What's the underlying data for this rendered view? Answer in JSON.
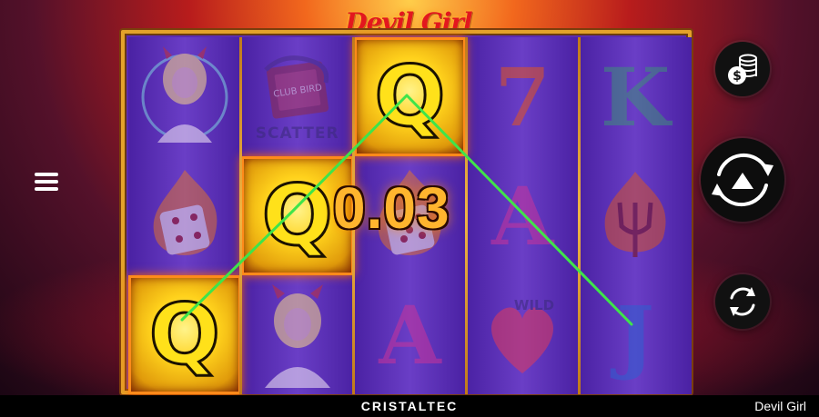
{
  "game": {
    "logo_text": "Devil Girl",
    "win_amount": "0.03"
  },
  "reels": [
    {
      "name": "reel-1",
      "symbols": [
        "girl",
        "dice",
        "Q"
      ]
    },
    {
      "name": "reel-2",
      "symbols": [
        "scatter-book",
        "Q",
        "girl"
      ]
    },
    {
      "name": "reel-3",
      "symbols": [
        "Q",
        "dice",
        "A"
      ]
    },
    {
      "name": "reel-4",
      "symbols": [
        "7",
        "A",
        "wild-heart"
      ]
    },
    {
      "name": "reel-5",
      "symbols": [
        "K",
        "trident",
        "J"
      ]
    }
  ],
  "labels": {
    "scatter": "SCATTER",
    "wild": "WILD",
    "A": "A",
    "K": "K",
    "J": "J",
    "Q": "Q",
    "seven": "7",
    "book_text": "CLUB BIRD"
  },
  "winning_line": {
    "symbol": "Q",
    "color": "#3fe44a"
  },
  "controls": {
    "menu_icon": "hamburger-menu-icon",
    "coins_icon": "coins-bet-icon",
    "spin_icon": "spin-icon",
    "autoplay_icon": "autoplay-icon"
  },
  "footer": {
    "brand": "CRISTALTEC",
    "game_name": "Devil Girl"
  },
  "colors": {
    "frame": "#e3a22a",
    "reel_bg": "#5a2bb0",
    "win_text": "#ffb52e"
  }
}
